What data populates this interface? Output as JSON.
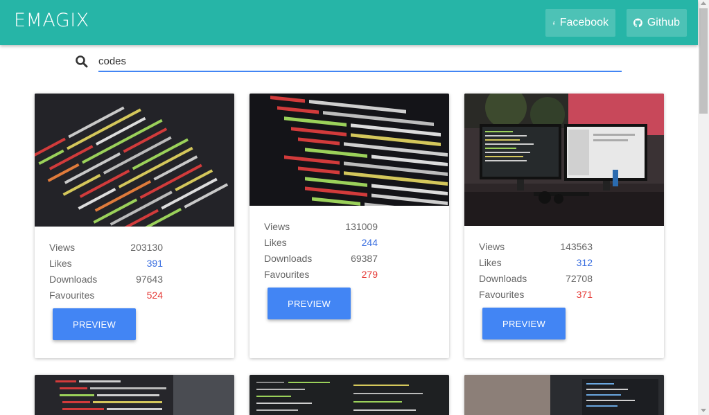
{
  "app": {
    "brand": "EMAGIX"
  },
  "nav": {
    "facebook": {
      "label": "Facebook",
      "icon": "facebook-icon"
    },
    "github": {
      "label": "Github",
      "icon": "github-icon"
    }
  },
  "search": {
    "value": "codes",
    "icon": "search-icon"
  },
  "colors": {
    "navbar": "#26b5a7",
    "accent": "#4285f4",
    "likes": "#3b6fe0",
    "favourites": "#e53935"
  },
  "cards": [
    {
      "views_label": "Views",
      "views": "203130",
      "likes_label": "Likes",
      "likes": "391",
      "downloads_label": "Downloads",
      "downloads": "97643",
      "favourites_label": "Favourites",
      "favourites": "524",
      "button": "PREVIEW"
    },
    {
      "views_label": "Views",
      "views": "131009",
      "likes_label": "Likes",
      "likes": "244",
      "downloads_label": "Downloads",
      "downloads": "69387",
      "favourites_label": "Favourites",
      "favourites": "279",
      "button": "PREVIEW"
    },
    {
      "views_label": "Views",
      "views": "143563",
      "likes_label": "Likes",
      "likes": "312",
      "downloads_label": "Downloads",
      "downloads": "72708",
      "favourites_label": "Favourites",
      "favourites": "371",
      "button": "PREVIEW"
    }
  ]
}
